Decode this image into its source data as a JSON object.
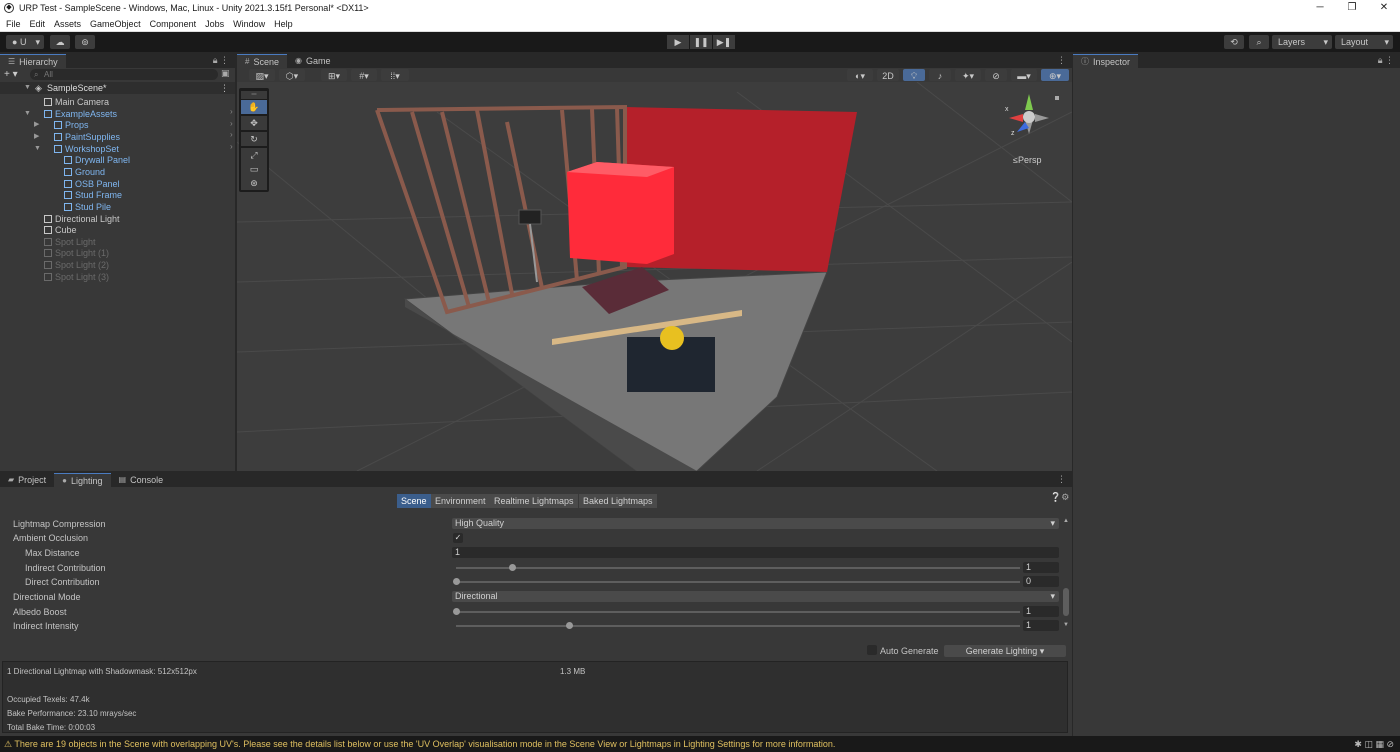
{
  "window": {
    "title": "URP Test - SampleScene - Windows, Mac, Linux - Unity 2021.3.15f1 Personal* <DX11>"
  },
  "menu": [
    "File",
    "Edit",
    "Assets",
    "GameObject",
    "Component",
    "Jobs",
    "Window",
    "Help"
  ],
  "toolbar": {
    "account_label": "U",
    "layers_label": "Layers",
    "layout_label": "Layout"
  },
  "hierarchy": {
    "tab": "Hierarchy",
    "search_placeholder": "All",
    "scene_name": "SampleScene*",
    "items": [
      {
        "label": "Main Camera",
        "depth": 1,
        "kind": "normal",
        "arrow": ""
      },
      {
        "label": "ExampleAssets",
        "depth": 1,
        "kind": "prefab",
        "arrow": "▼"
      },
      {
        "label": "Props",
        "depth": 2,
        "kind": "prefab",
        "arrow": "▶"
      },
      {
        "label": "PaintSupplies",
        "depth": 2,
        "kind": "prefab",
        "arrow": "▶"
      },
      {
        "label": "WorkshopSet",
        "depth": 2,
        "kind": "prefab",
        "arrow": "▼"
      },
      {
        "label": "Drywall Panel",
        "depth": 3,
        "kind": "prefab",
        "arrow": ""
      },
      {
        "label": "Ground",
        "depth": 3,
        "kind": "prefab",
        "arrow": ""
      },
      {
        "label": "OSB Panel",
        "depth": 3,
        "kind": "prefab",
        "arrow": ""
      },
      {
        "label": "Stud Frame",
        "depth": 3,
        "kind": "prefab",
        "arrow": ""
      },
      {
        "label": "Stud Pile",
        "depth": 3,
        "kind": "prefab",
        "arrow": ""
      },
      {
        "label": "Directional Light",
        "depth": 1,
        "kind": "normal",
        "arrow": ""
      },
      {
        "label": "Cube",
        "depth": 1,
        "kind": "normal",
        "arrow": ""
      },
      {
        "label": "Spot Light",
        "depth": 1,
        "kind": "disabled",
        "arrow": ""
      },
      {
        "label": "Spot Light (1)",
        "depth": 1,
        "kind": "disabled",
        "arrow": ""
      },
      {
        "label": "Spot Light (2)",
        "depth": 1,
        "kind": "disabled",
        "arrow": ""
      },
      {
        "label": "Spot Light (3)",
        "depth": 1,
        "kind": "disabled",
        "arrow": ""
      }
    ]
  },
  "scene_view": {
    "tabs": [
      "Scene",
      "Game"
    ],
    "btn_2d": "2D",
    "persp_label": "≤Persp",
    "axis_x": "x",
    "axis_z": "z"
  },
  "inspector": {
    "tab": "Inspector"
  },
  "bottom": {
    "tabs": [
      "Project",
      "Lighting",
      "Console"
    ],
    "subtabs": [
      "Scene",
      "Environment",
      "Realtime Lightmaps",
      "Baked Lightmaps"
    ],
    "props": {
      "lightmap_compression": {
        "label": "Lightmap Compression",
        "value": "High Quality"
      },
      "ambient_occlusion": {
        "label": "Ambient Occlusion",
        "checked": "✓"
      },
      "max_distance": {
        "label": "Max Distance",
        "value": "1"
      },
      "indirect_contribution": {
        "label": "Indirect Contribution",
        "value": "1",
        "fraction": 0.1
      },
      "direct_contribution": {
        "label": "Direct Contribution",
        "value": "0",
        "fraction": 0.0
      },
      "directional_mode": {
        "label": "Directional Mode",
        "value": "Directional"
      },
      "albedo_boost": {
        "label": "Albedo Boost",
        "value": "1",
        "fraction": 0.0
      },
      "indirect_intensity": {
        "label": "Indirect Intensity",
        "value": "1",
        "fraction": 0.2
      }
    },
    "auto_generate": "Auto Generate",
    "generate_lighting": "Generate Lighting",
    "info": {
      "lightmap_line": "1 Directional Lightmap with Shadowmask: 512x512px",
      "lightmap_size": "1.3 MB",
      "occupied_texels": "Occupied Texels: 47.4k",
      "bake_performance": "Bake Performance: 23.10 mrays/sec",
      "total_bake_time": "Total Bake Time: 0:00:03"
    }
  },
  "status": {
    "message": "There are 19 objects in the Scene with overlapping UV's. Please see the details list below or use the 'UV Overlap' visualisation mode in the Scene View or Lightmaps in Lighting Settings for more information."
  },
  "colors": {
    "accent": "#4a7bc0",
    "prefab_text": "#7fb6f0",
    "warning": "#e0c060",
    "red_wall": "#c0222c"
  }
}
